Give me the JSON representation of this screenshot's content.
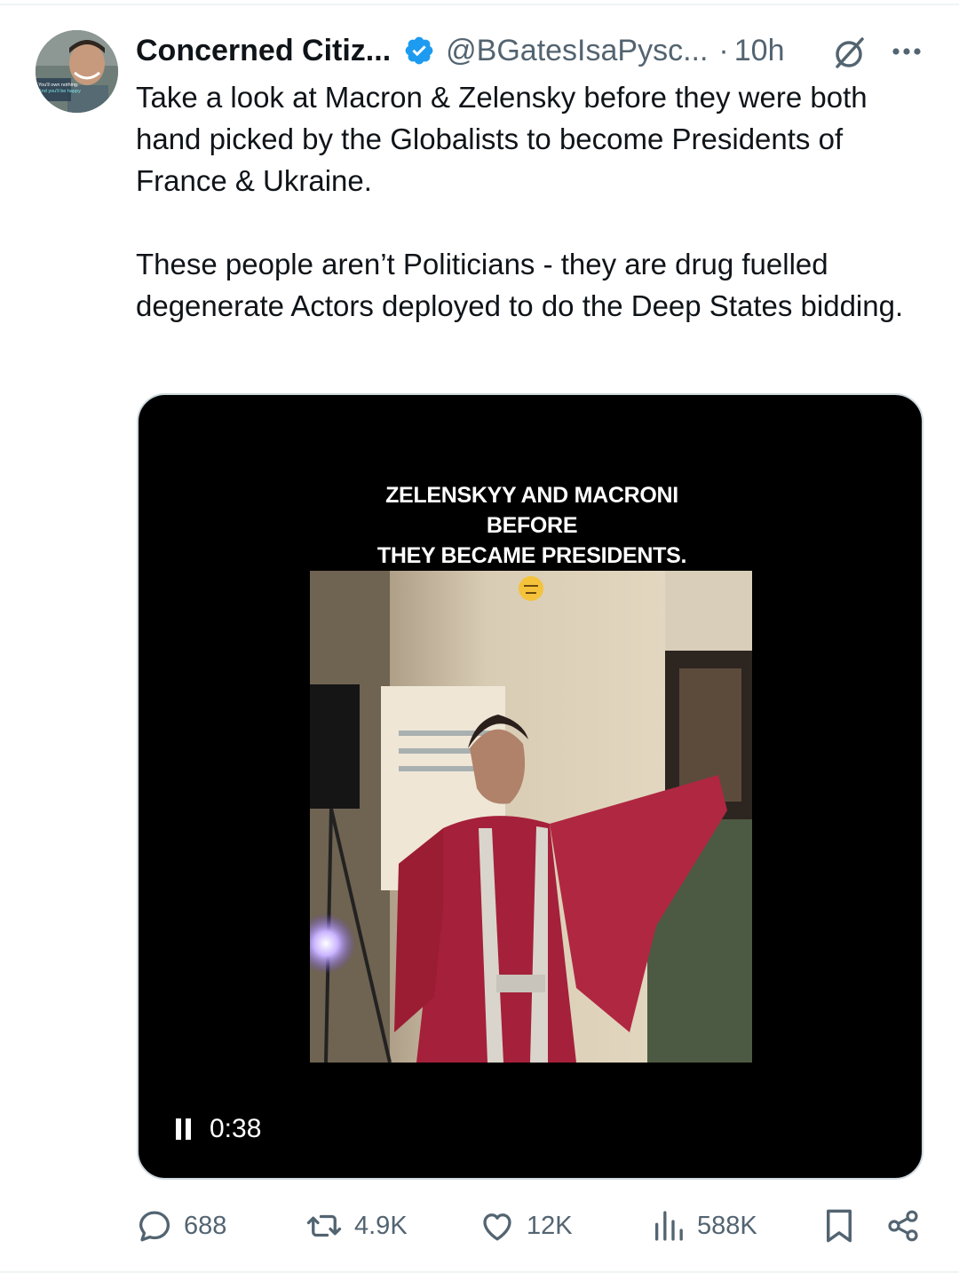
{
  "tweet": {
    "display_name": "Concerned Citiz...",
    "handle": "@BGatesIsaPysc...",
    "separator": "·",
    "time": "10h",
    "paragraphs": [
      "Take a look at Macron & Zelensky before they were both hand picked by the Globalists to become Presidents of France & Ukraine.",
      "These people aren’t Politicians - they are drug fuelled degenerate Actors deployed to do the Deep States bidding."
    ]
  },
  "avatar": {
    "overlay_lines": [
      "You'll own nothing.",
      "And you'll be happy"
    ]
  },
  "media": {
    "caption_lines": [
      "ZELENSKYY AND MACRONI",
      "BEFORE",
      "THEY BECAME PRESIDENTS."
    ],
    "emoji": "expressionless-face",
    "video_time": "0:38",
    "state": "playing"
  },
  "actions": {
    "replies": "688",
    "reposts": "4.9K",
    "likes": "12K",
    "views": "588K"
  },
  "icons": {
    "verified": "verified-badge-icon",
    "grok": "grok-icon",
    "more": "more-icon",
    "reply": "reply-icon",
    "repost": "repost-icon",
    "like": "heart-icon",
    "views": "views-icon",
    "bookmark": "bookmark-icon",
    "share": "share-icon"
  },
  "colors": {
    "text": "#0f1419",
    "secondary": "#536471",
    "verified": "#1d9bf0",
    "divider": "#eff3f4"
  }
}
